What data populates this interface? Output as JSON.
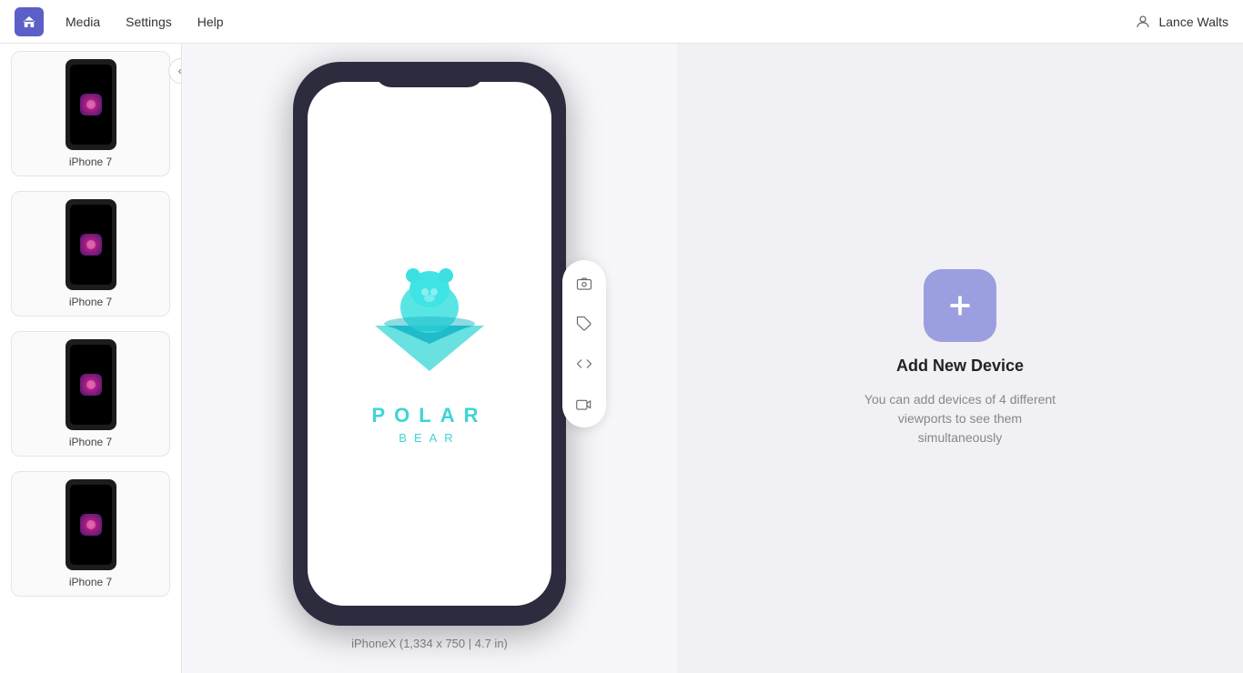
{
  "nav": {
    "logo_label": "Home",
    "links": [
      {
        "label": "Media",
        "id": "media"
      },
      {
        "label": "Settings",
        "id": "settings"
      },
      {
        "label": "Help",
        "id": "help"
      }
    ],
    "user": {
      "icon": "user-circle",
      "name": "Lance Walts"
    }
  },
  "sidebar": {
    "collapse_icon": "«",
    "devices": [
      {
        "label": "iPhone 7",
        "id": "device-1"
      },
      {
        "label": "iPhone 7",
        "id": "device-2"
      },
      {
        "label": "iPhone 7",
        "id": "device-3"
      },
      {
        "label": "iPhone 7",
        "id": "device-4"
      }
    ]
  },
  "main": {
    "device_name": "iPhoneX",
    "device_res": "1,334 x 750",
    "device_size": "4.7 in",
    "device_label_full": "iPhoneX (1,334 x 750  |  4.7 in)",
    "app_name": "POLAR",
    "app_sub": "BEAR",
    "toolbar": [
      {
        "icon": "camera",
        "label": "Screenshot"
      },
      {
        "icon": "tag",
        "label": "Annotate"
      },
      {
        "icon": "code",
        "label": "Inspect"
      },
      {
        "icon": "video",
        "label": "Record"
      }
    ]
  },
  "add_device": {
    "title": "Add New Device",
    "description": "You can add devices of 4 different viewports to see them simultaneously",
    "button_icon": "plus",
    "button_label": "Add"
  }
}
